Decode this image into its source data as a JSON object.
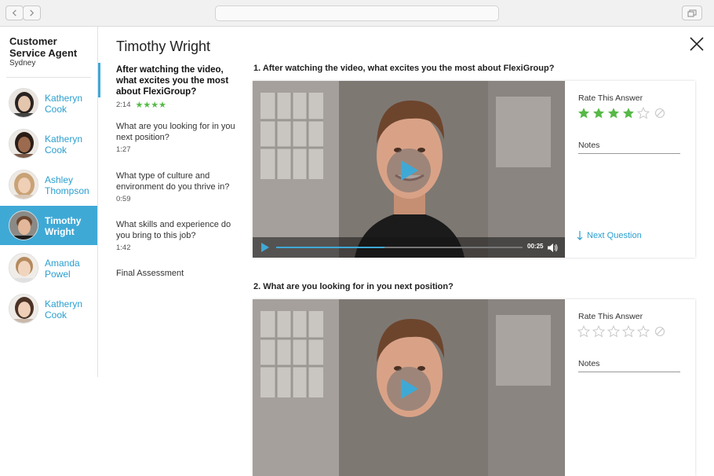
{
  "sidebar": {
    "role_title": "Customer Service Agent",
    "role_city": "Sydney",
    "candidates": [
      {
        "name": "Katheryn Cook",
        "active": false
      },
      {
        "name": "Katheryn Cook",
        "active": false
      },
      {
        "name": "Ashley Thompson",
        "active": false
      },
      {
        "name": "Timothy Wright",
        "active": true
      },
      {
        "name": "Amanda Powel",
        "active": false
      },
      {
        "name": "Katheryn Cook",
        "active": false
      }
    ]
  },
  "main": {
    "title": "Timothy Wright",
    "question_nav": [
      {
        "title": "After watching the video, what excites you the most about FlexiGroup?",
        "time": "2:14",
        "rating": 4,
        "active": true
      },
      {
        "title": "What are you looking for in you next position?",
        "time": "1:27"
      },
      {
        "title": "What type of culture and environment do you thrive in?",
        "time": "0:59"
      },
      {
        "title": "What skills and experience do you bring to this job?",
        "time": "1:42"
      },
      {
        "title": "Final Assessment"
      }
    ],
    "questions": [
      {
        "heading": "1. After watching the video, what excites you the most about FlexiGroup?",
        "video_time": "00:25",
        "progress": 0.44,
        "rate_label": "Rate This Answer",
        "rating": 4,
        "notes_label": "Notes",
        "next_label": "Next Question"
      },
      {
        "heading": "2. What are you looking for in you next position?",
        "rate_label": "Rate This Answer",
        "rating": 0,
        "notes_label": "Notes"
      }
    ]
  },
  "colors": {
    "accent": "#3fa9d6",
    "star_filled": "#57b947",
    "star_empty": "#c8c8c8"
  },
  "icons": [
    "back-icon",
    "forward-icon",
    "window-icon",
    "close-icon",
    "play-icon",
    "volume-icon",
    "star-icon",
    "clear-rating-icon",
    "arrow-down-icon"
  ]
}
